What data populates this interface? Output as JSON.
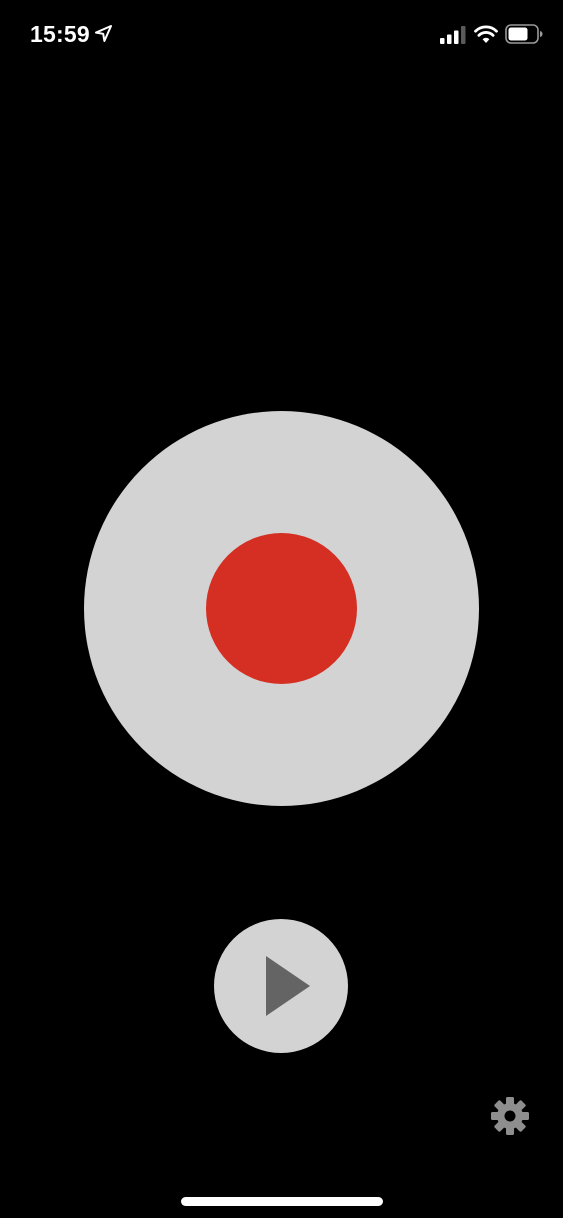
{
  "status_bar": {
    "time": "15:59",
    "icons": {
      "location": "location-arrow-icon",
      "cellular": "cellular-signal-icon",
      "wifi": "wifi-icon",
      "battery": "battery-icon"
    }
  },
  "controls": {
    "record": {
      "icon": "record-dot-icon"
    },
    "play": {
      "icon": "play-icon"
    },
    "settings": {
      "icon": "gear-icon"
    }
  },
  "colors": {
    "background": "#000000",
    "button_fill": "#d3d3d3",
    "record_red": "#d42f22",
    "play_glyph": "#646464",
    "gear": "#8e8e8e",
    "status_text": "#ffffff"
  }
}
